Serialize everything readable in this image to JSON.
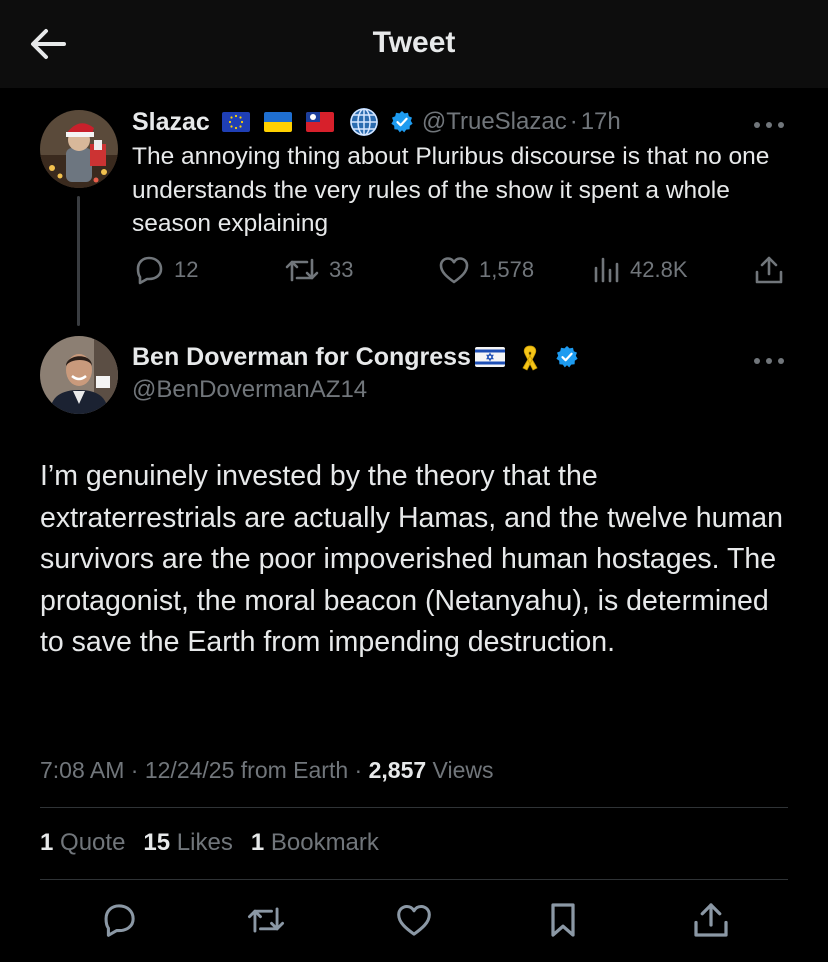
{
  "header": {
    "title": "Tweet"
  },
  "parent_tweet": {
    "name": "Slazac",
    "handle": "@TrueSlazac",
    "separator": "·",
    "time": "17h",
    "text": "The annoying thing about Pluribus discourse is that no one understands the very rules of the show it spent a whole season explaining",
    "icons": [
      "eu-flag-icon",
      "ukraine-flag-icon",
      "taiwan-flag-icon",
      "globe-icon",
      "verified-badge-icon"
    ],
    "actions": {
      "replies": "12",
      "retweets": "33",
      "likes": "1,578",
      "views": "42.8K"
    }
  },
  "main_tweet": {
    "name": "Ben Doverman for Congress",
    "handle": "@BenDovermanAZ14",
    "icons": [
      "israel-flag-icon",
      "yellow-ribbon-icon",
      "verified-badge-icon"
    ],
    "text": "I’m genuinely invested by the theory that the extraterrestrials are actually Hamas, and the twelve human survivors are the poor impoverished human hostages. The protagonist, the moral beacon (Netanyahu), is determined to save the Earth from impending destruction.",
    "time": "7:08 AM",
    "date": "12/24/25",
    "source": "from Earth",
    "sep": "·",
    "views_count": "2,857",
    "views_label": "Views",
    "stats": {
      "quotes_count": "1",
      "quotes_label": "Quote",
      "likes_count": "15",
      "likes_label": "Likes",
      "bookmarks_count": "1",
      "bookmarks_label": "Bookmark"
    }
  },
  "colors": {
    "background": "#000000",
    "header_bg": "#0d0d0d",
    "text_primary": "#e7e9ea",
    "text_secondary": "#71767b",
    "verified": "#1d9bf0",
    "divider": "#2f3336"
  }
}
